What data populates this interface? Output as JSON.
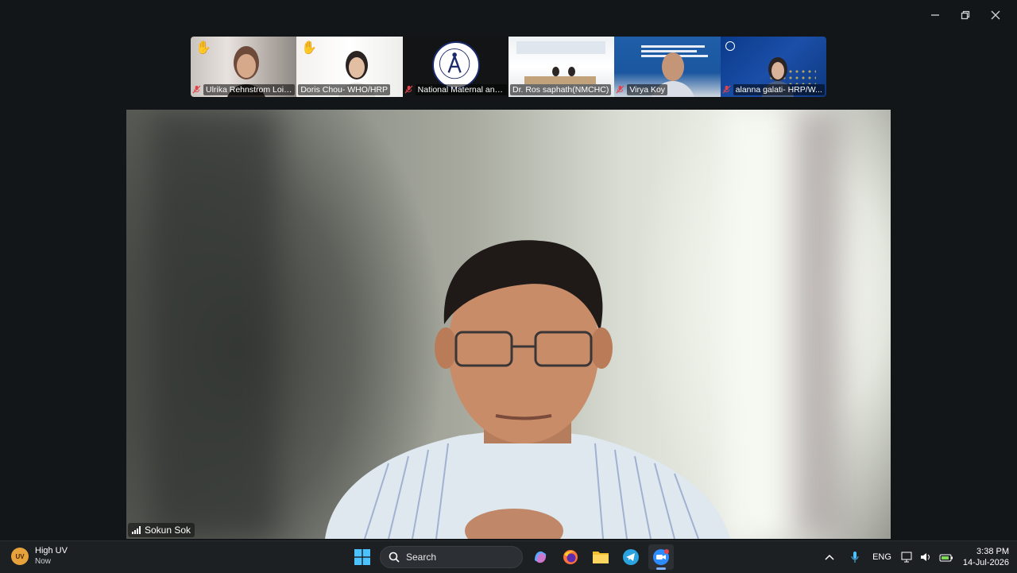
{
  "window": {
    "minimize_label": "minimize",
    "restore_label": "restore",
    "close_label": "close"
  },
  "participants": [
    {
      "name": "Ulrika Rehnstrom Loi -...",
      "hand_raised": true,
      "muted": true
    },
    {
      "name": "Doris Chou- WHO/HRP",
      "hand_raised": true,
      "muted": false
    },
    {
      "name": "National Maternal and ...",
      "hand_raised": false,
      "muted": true
    },
    {
      "name": "Dr. Ros saphath(NMCHC)",
      "hand_raised": false,
      "muted": false
    },
    {
      "name": "Virya Koy",
      "hand_raised": false,
      "muted": true
    },
    {
      "name": "alanna galati- HRP/W...",
      "hand_raised": false,
      "muted": true
    }
  ],
  "main_speaker": {
    "name": "Sokun Sok"
  },
  "taskbar": {
    "weather": {
      "badge": "UV",
      "title": "High UV",
      "subtitle": "Now"
    },
    "search_placeholder": "Search",
    "apps": [
      "start-icon",
      "search",
      "copilot-icon",
      "firefox-icon",
      "file-explorer-icon",
      "telegram-icon",
      "zoom-icon"
    ],
    "language": "ENG",
    "time": "3:38 PM",
    "date": "14-Jul-2026"
  },
  "colors": {
    "background": "#131619",
    "taskbar": "#1d2023",
    "accent": "#7eb1ff",
    "muted_red": "#e0444a"
  }
}
